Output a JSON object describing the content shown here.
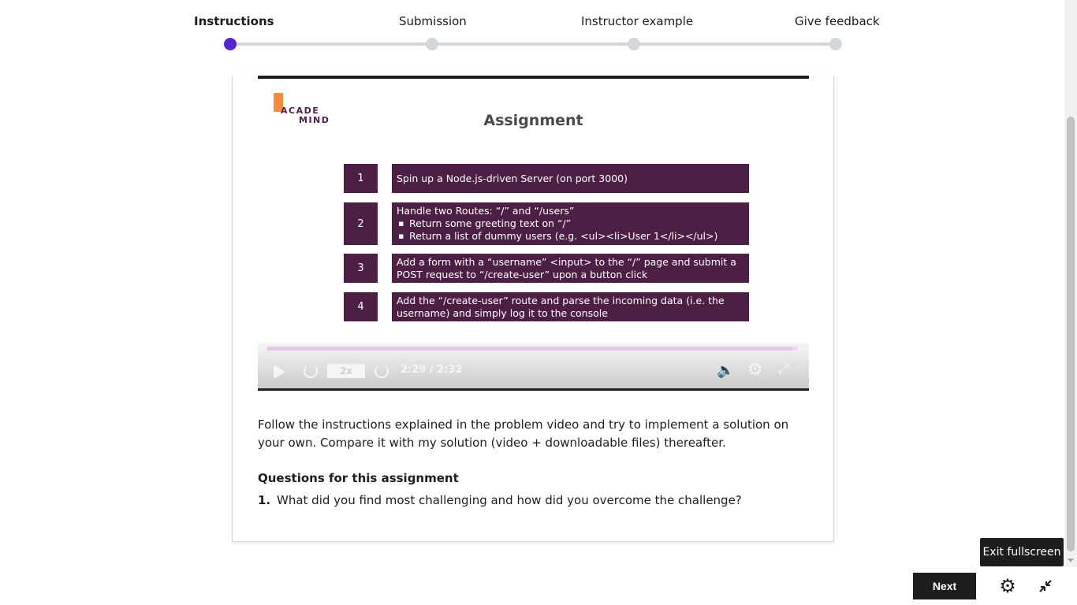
{
  "steps": [
    {
      "label": "Instructions",
      "active": true
    },
    {
      "label": "Submission",
      "active": false
    },
    {
      "label": "Instructor example",
      "active": false
    },
    {
      "label": "Give feedback",
      "active": false
    }
  ],
  "slide": {
    "logo_line1": "ACADE",
    "logo_line2": "MIND",
    "title": "Assignment",
    "rows": [
      {
        "num": "1",
        "text": "Spin up a Node.js-driven Server (on port 3000)",
        "bullets": []
      },
      {
        "num": "2",
        "text": "Handle two Routes: “/” and “/users”",
        "bullets": [
          "Return some greeting text on “/”",
          "Return a list of dummy users (e.g. <ul><li>User 1</li></ul>)"
        ]
      },
      {
        "num": "3",
        "text": "Add a form with a “username” <input> to the “/” page and submit a POST request to “/create-user” upon a button click",
        "bullets": []
      },
      {
        "num": "4",
        "text": "Add the “/create-user” route and parse the incoming data (i.e. the username) and simply log it to the console",
        "bullets": []
      }
    ]
  },
  "player": {
    "speed": "2x",
    "time": "2:29 / 2:32",
    "progress": 0.99,
    "icons": [
      "play-icon",
      "rewind-icon",
      "forward-icon",
      "volume-icon",
      "gear-icon",
      "fullscreen-icon"
    ]
  },
  "description": "Follow the instructions explained in the problem video and try to implement a solution on your own. Compare it with my solution (video + downloadable files) thereafter.",
  "questions": {
    "title": "Questions for this assignment",
    "items": [
      {
        "num": "1.",
        "text": "What did you find most challenging and how did you overcome the challenge?"
      }
    ]
  },
  "footer": {
    "tooltip": "Exit fullscreen",
    "next_label": "Next",
    "icons": [
      "gear-icon",
      "exit-fullscreen-icon"
    ]
  },
  "colors": {
    "accent": "#5624d0",
    "slide_box": "#4e1f44",
    "logo_orange": "#f48c3c",
    "dark": "#1c1d1f"
  }
}
